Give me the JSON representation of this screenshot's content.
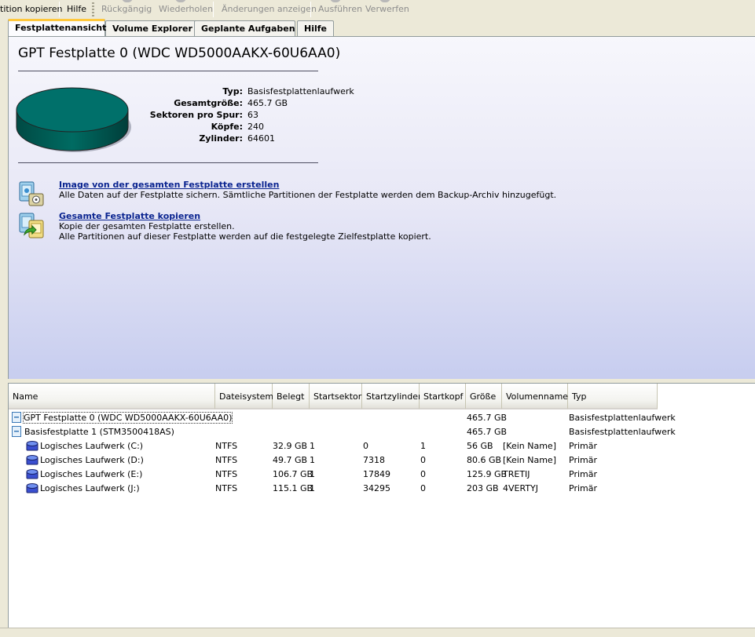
{
  "toolbar": {
    "partition_copy": "tition kopieren",
    "help": "Hilfe",
    "undo": "Rückgängig",
    "redo": "Wiederholen",
    "show_changes": "Änderungen anzeigen",
    "execute": "Ausführen",
    "discard": "Verwerfen"
  },
  "tabs": [
    "Festplattenansicht",
    "Volume Explorer",
    "Geplante Aufgaben",
    "Hilfe"
  ],
  "disk": {
    "title": "GPT Festplatte 0 (WDC WD5000AAKX-60U6AA0)",
    "props": [
      {
        "label": "Typ:",
        "value": "Basisfestplattenlaufwerk"
      },
      {
        "label": "Gesamtgröße:",
        "value": "465.7 GB"
      },
      {
        "label": "Sektoren pro Spur:",
        "value": "63"
      },
      {
        "label": "Köpfe:",
        "value": "240"
      },
      {
        "label": "Zylinder:",
        "value": "64601"
      }
    ]
  },
  "actions": [
    {
      "title": "Image von der gesamten Festplatte erstellen",
      "desc1": "Alle Daten auf der Festplatte sichern. Sämtliche Partitionen der Festplatte werden dem Backup-Archiv hinzugefügt.",
      "desc2": ""
    },
    {
      "title": "Gesamte Festplatte kopieren",
      "desc1": "Kopie der gesamten Festplatte erstellen.",
      "desc2": "Alle Partitionen auf dieser Festplatte werden auf die festgelegte Zielfestplatte kopiert."
    }
  ],
  "columns": [
    "Name",
    "Dateisystem",
    "Belegt",
    "Startsektor",
    "Startzylinder",
    "Startkopf",
    "Größe",
    "Volumenname",
    "Typ"
  ],
  "rows": [
    {
      "name": "GPT Festplatte 0 (WDC WD5000AAKX-60U6AA0)",
      "fs": "",
      "used": "",
      "ssec": "",
      "scyl": "",
      "shead": "",
      "size": "465.7 GB",
      "vol": "",
      "type": "Basisfestplattenlaufwerk",
      "kind": "disk"
    },
    {
      "name": "Basisfestplatte 1 (STM3500418AS)",
      "fs": "",
      "used": "",
      "ssec": "",
      "scyl": "",
      "shead": "",
      "size": "465.7 GB",
      "vol": "",
      "type": "Basisfestplattenlaufwerk",
      "kind": "disk"
    },
    {
      "name": "Logisches Laufwerk (C:)",
      "fs": "NTFS",
      "used": "32.9 GB",
      "ssec": "1",
      "scyl": "0",
      "shead": "1",
      "size": "56 GB",
      "vol": "[Kein Name]",
      "type": "Primär",
      "kind": "volume"
    },
    {
      "name": "Logisches Laufwerk (D:)",
      "fs": "NTFS",
      "used": "49.7 GB",
      "ssec": "1",
      "scyl": "7318",
      "shead": "0",
      "size": "80.6 GB",
      "vol": "[Kein Name]",
      "type": "Primär",
      "kind": "volume"
    },
    {
      "name": "Logisches Laufwerk (E:)",
      "fs": "NTFS",
      "used": "106.7 GB",
      "ssec": "1",
      "scyl": "17849",
      "shead": "0",
      "size": "125.9 GB",
      "vol": "TRETIJ",
      "type": "Primär",
      "kind": "volume"
    },
    {
      "name": "Logisches Laufwerk (J:)",
      "fs": "NTFS",
      "used": "115.1 GB",
      "ssec": "1",
      "scyl": "34295",
      "shead": "0",
      "size": "203 GB",
      "vol": "4VERTYJ",
      "type": "Primär",
      "kind": "volume"
    }
  ],
  "colors": {
    "link": "#0a2490",
    "disk_fill": "#006e66",
    "active_tab_accent": "#ffc83c"
  }
}
